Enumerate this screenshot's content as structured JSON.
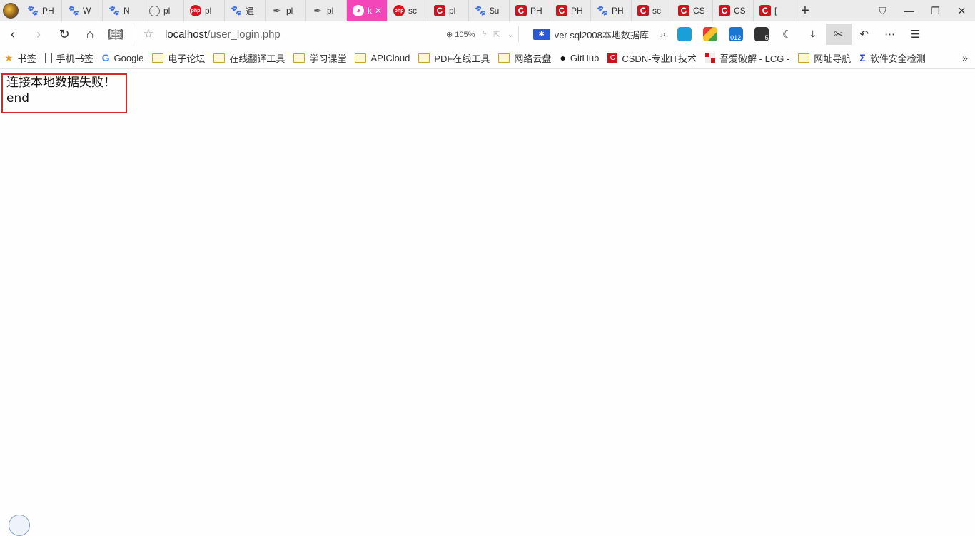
{
  "tabs": [
    {
      "icon": "paw-icon",
      "label": "PH",
      "active": false
    },
    {
      "icon": "paw-icon",
      "label": "W",
      "active": false
    },
    {
      "icon": "paw-icon",
      "label": "N",
      "active": false
    },
    {
      "icon": "globe-icon",
      "label": "pl",
      "active": false
    },
    {
      "icon": "php-icon",
      "label": "pl",
      "active": false
    },
    {
      "icon": "paw-icon",
      "label": "通",
      "active": false
    },
    {
      "icon": "feather-icon",
      "label": "pl",
      "active": false
    },
    {
      "icon": "feather-icon",
      "label": "pl",
      "active": false
    },
    {
      "icon": "pink-logo-icon",
      "label": "k",
      "active": true
    },
    {
      "icon": "php-icon",
      "label": "sc",
      "active": false
    },
    {
      "icon": "csdn-icon",
      "label": "pl",
      "active": false
    },
    {
      "icon": "paw-icon",
      "label": "$u",
      "active": false
    },
    {
      "icon": "csdn-icon",
      "label": "PH",
      "active": false
    },
    {
      "icon": "csdn-icon",
      "label": "PH",
      "active": false
    },
    {
      "icon": "paw-icon",
      "label": "PH",
      "active": false
    },
    {
      "icon": "csdn-icon",
      "label": "sc",
      "active": false
    },
    {
      "icon": "csdn-icon",
      "label": "CS",
      "active": false
    },
    {
      "icon": "csdn-icon",
      "label": "CS",
      "active": false
    },
    {
      "icon": "csdn-icon",
      "label": "[",
      "active": false
    }
  ],
  "address": {
    "host": "localhost",
    "path": "/user_login.php",
    "zoom": "105%"
  },
  "search": {
    "query": "ver sql2008本地数据库"
  },
  "ext_badges": {
    "counter": "012",
    "notif": "5"
  },
  "bookmarks": [
    {
      "icon": "star-icon",
      "label": "书签"
    },
    {
      "icon": "phone-icon",
      "label": "手机书签"
    },
    {
      "icon": "google-icon",
      "label": "Google"
    },
    {
      "icon": "folder-icon",
      "label": "电子论坛"
    },
    {
      "icon": "folder-icon",
      "label": "在线翻译工具"
    },
    {
      "icon": "folder-icon",
      "label": "学习课堂"
    },
    {
      "icon": "folder-icon",
      "label": "APICloud"
    },
    {
      "icon": "folder-icon",
      "label": "PDF在线工具"
    },
    {
      "icon": "folder-icon",
      "label": "网络云盘"
    },
    {
      "icon": "github-icon",
      "label": "GitHub"
    },
    {
      "icon": "csdn-icon",
      "label": "CSDN-专业IT技术"
    },
    {
      "icon": "52pojie-icon",
      "label": "吾爱破解 - LCG -"
    },
    {
      "icon": "folder-icon",
      "label": "网址导航"
    },
    {
      "icon": "sigma-icon",
      "label": "软件安全检测"
    }
  ],
  "content": {
    "line1": "连接本地数据失败！",
    "line2": "end"
  }
}
